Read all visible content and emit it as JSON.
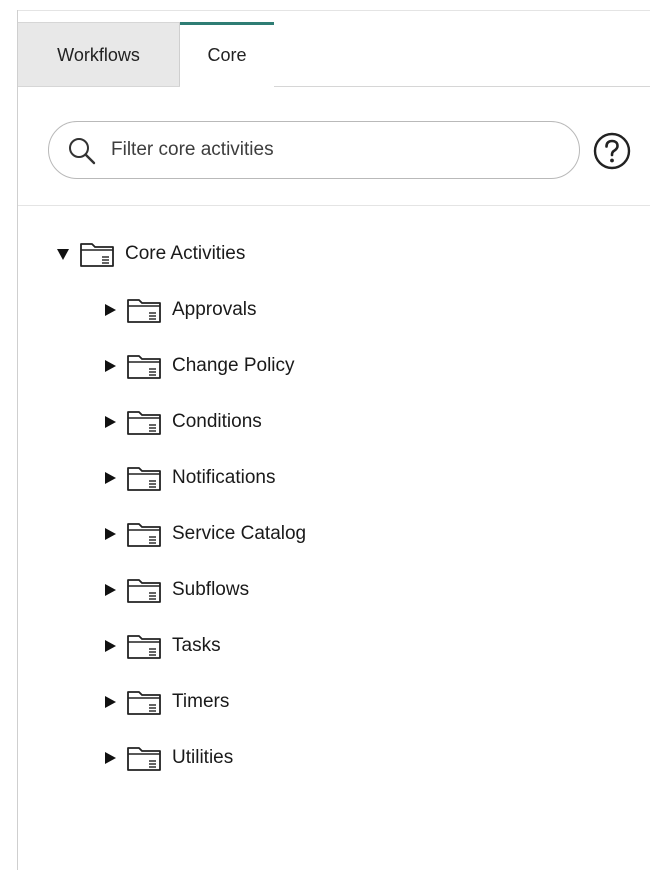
{
  "tabs": [
    {
      "label": "Workflows",
      "active": false
    },
    {
      "label": "Core",
      "active": true
    }
  ],
  "search": {
    "value": "",
    "placeholder": "Filter core activities"
  },
  "help_icon": "help-icon",
  "tree": {
    "root": {
      "label": "Core Activities",
      "expanded": true
    },
    "children": [
      {
        "label": "Approvals",
        "expanded": false
      },
      {
        "label": "Change Policy",
        "expanded": false
      },
      {
        "label": "Conditions",
        "expanded": false
      },
      {
        "label": "Notifications",
        "expanded": false
      },
      {
        "label": "Service Catalog",
        "expanded": false
      },
      {
        "label": "Subflows",
        "expanded": false
      },
      {
        "label": "Tasks",
        "expanded": false
      },
      {
        "label": "Timers",
        "expanded": false
      },
      {
        "label": "Utilities",
        "expanded": false
      }
    ]
  },
  "colors": {
    "active_tab_accent": "#2e7d74",
    "inactive_tab_bg": "#e8e8e8"
  }
}
